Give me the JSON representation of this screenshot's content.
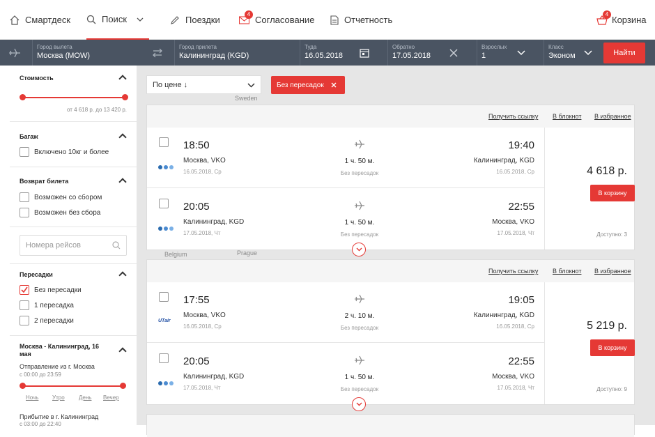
{
  "nav": {
    "items": [
      {
        "label": "Смартдеск",
        "icon": "home-icon"
      },
      {
        "label": "Поиск",
        "icon": "search-icon"
      },
      {
        "label": "Поездки",
        "icon": "pencil-icon"
      },
      {
        "label": "Согласование",
        "icon": "mail-icon",
        "badge": "4"
      },
      {
        "label": "Отчетность",
        "icon": "document-icon"
      }
    ],
    "cart": {
      "label": "Корзина",
      "badge": "4",
      "icon": "basket-icon"
    }
  },
  "search": {
    "from": {
      "label": "Город вылета",
      "value": "Москва (MOW)"
    },
    "to": {
      "label": "Город прилета",
      "value": "Калининград (KGD)"
    },
    "there": {
      "label": "Туда",
      "value": "16.05.2018"
    },
    "back": {
      "label": "Обратно",
      "value": "17.05.2018"
    },
    "adults": {
      "label": "Взрослых",
      "value": "1"
    },
    "class": {
      "label": "Класс",
      "value": "Эконом"
    },
    "button": "Найти"
  },
  "map": {
    "labels": [
      "Sweden",
      "Belgium",
      "Prague"
    ]
  },
  "filters": {
    "price": {
      "title": "Стоимость",
      "range": "от 4 618 р. до 13 420 р."
    },
    "baggage": {
      "title": "Багаж",
      "option": "Включено 10кг и более"
    },
    "refund": {
      "title": "Возврат билета",
      "options": [
        "Возможен со сбором",
        "Возможен без сбора"
      ]
    },
    "flight_numbers": {
      "placeholder": "Номера рейсов"
    },
    "stops": {
      "title": "Пересадки",
      "options": [
        "Без пересадки",
        "1 пересадка",
        "2 пересадки"
      ],
      "checked": 0
    },
    "route": {
      "title": "Москва - Калининград, 16 мая",
      "departure": "Отправление из г. Москва",
      "departure_range": "с 00:00 до 23:59",
      "times": [
        "Ночь",
        "Утро",
        "День",
        "Вечер"
      ],
      "arrival": "Прибытие в г. Калининград",
      "arrival_range": "с 03:00 до 22:40"
    }
  },
  "toolbar": {
    "sort_label": "По цене ↓",
    "tag_label": "Без пересадок"
  },
  "card_links": [
    "Получить ссылку",
    "В блокнот",
    "В избранное"
  ],
  "offers": [
    {
      "price": "4 618 р.",
      "buy_label": "В корзину",
      "available": "Доступно: 3",
      "segments": [
        {
          "dep_time": "18:50",
          "dep_city": "Москва, VKO",
          "dep_date": "16.05.2018, Ср",
          "duration": "1 ч. 50 м.",
          "stops": "Без пересадок",
          "arr_time": "19:40",
          "arr_city": "Калининград, KGD",
          "arr_date": "16.05.2018, Ср",
          "airline": "dots"
        },
        {
          "dep_time": "20:05",
          "dep_city": "Калининград, KGD",
          "dep_date": "17.05.2018, Чт",
          "duration": "1 ч. 50 м.",
          "stops": "Без пересадок",
          "arr_time": "22:55",
          "arr_city": "Москва, VKO",
          "arr_date": "17.05.2018, Чт",
          "airline": "dots"
        }
      ]
    },
    {
      "price": "5 219 р.",
      "buy_label": "В корзину",
      "available": "Доступно: 9",
      "segments": [
        {
          "dep_time": "17:55",
          "dep_city": "Москва, VKO",
          "dep_date": "16.05.2018, Ср",
          "duration": "2 ч. 10 м.",
          "stops": "Без пересадок",
          "arr_time": "19:05",
          "arr_city": "Калининград, KGD",
          "arr_date": "16.05.2018, Ср",
          "airline": "UTair"
        },
        {
          "dep_time": "20:05",
          "dep_city": "Калининград, KGD",
          "dep_date": "17.05.2018, Чт",
          "duration": "1 ч. 50 м.",
          "stops": "Без пересадок",
          "arr_time": "22:55",
          "arr_city": "Москва, VKO",
          "arr_date": "17.05.2018, Чт",
          "airline": "dots"
        }
      ]
    }
  ],
  "colors": {
    "accent": "#e53935",
    "bar": "#4a5462"
  }
}
